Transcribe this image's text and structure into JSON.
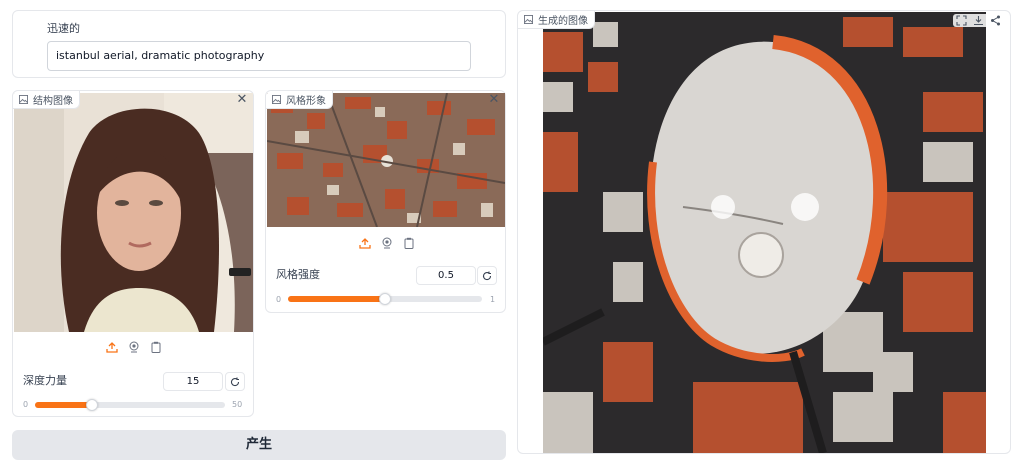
{
  "prompt": {
    "label": "迅速的",
    "value": "istanbul aerial, dramatic photography"
  },
  "structure": {
    "label": "结构图像",
    "strength_label": "深度力量",
    "strength_value": "15",
    "min": "0",
    "max": "50",
    "fraction": 0.3
  },
  "style": {
    "label": "风格形象",
    "strength_label": "风格强度",
    "strength_value": "0.5",
    "min": "0",
    "max": "1",
    "fraction": 0.5
  },
  "output": {
    "label": "生成的图像"
  },
  "generate_button": {
    "label": "产生"
  },
  "colors": {
    "accent": "#f97316",
    "button_bg": "#e5e7eb"
  },
  "icons": [
    "image-icon",
    "close-icon",
    "upload-icon",
    "webcam-icon",
    "clipboard-icon",
    "reset-icon",
    "fullscreen-icon",
    "download-icon",
    "share-icon"
  ]
}
